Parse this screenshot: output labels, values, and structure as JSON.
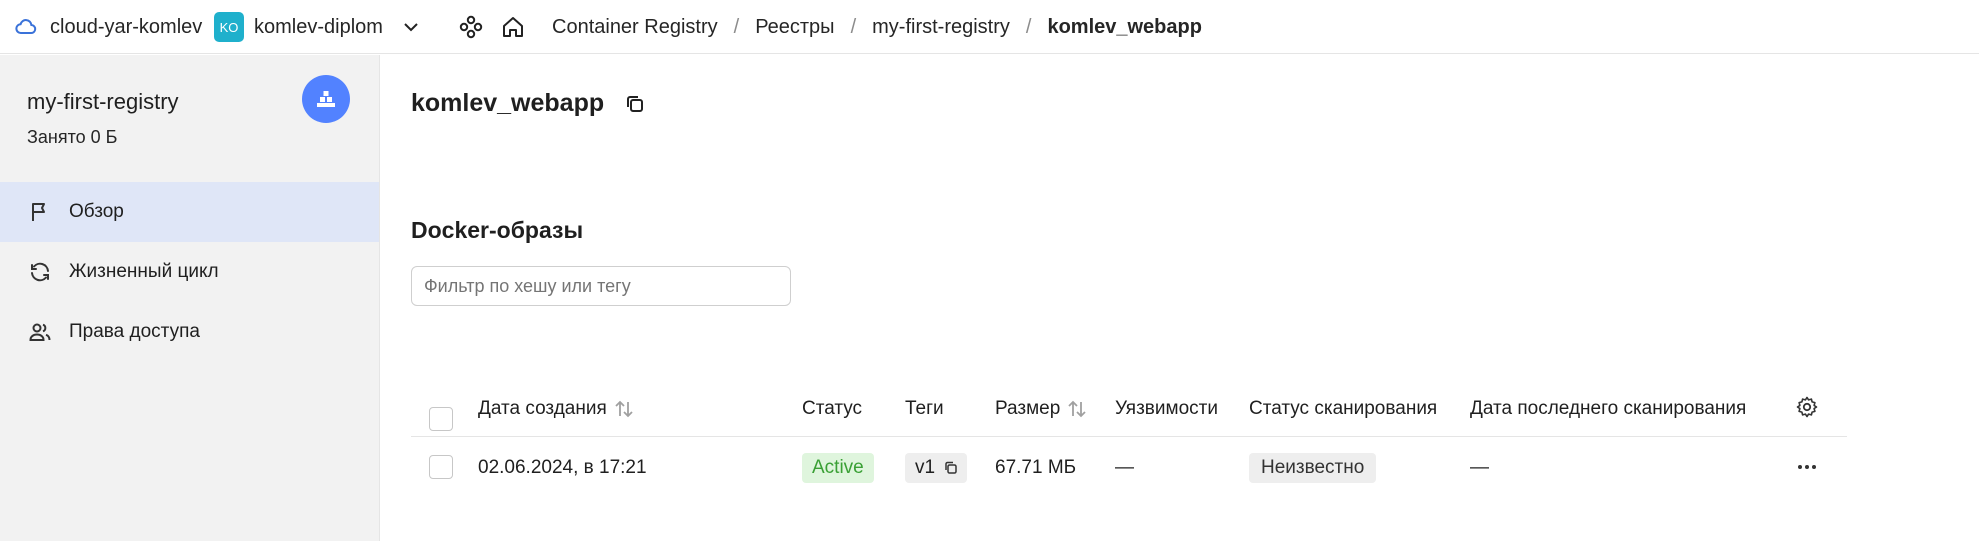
{
  "topbar": {
    "cloud": "cloud-yar-komlev",
    "folder_badge": "KO",
    "folder": "komlev-diplom",
    "breadcrumbs": [
      "Container Registry",
      "Реестры",
      "my-first-registry",
      "komlev_webapp"
    ],
    "separator": "/"
  },
  "sidebar": {
    "registry_name": "my-first-registry",
    "occupied": "Занято 0 Б",
    "items": [
      {
        "label": "Обзор",
        "icon": "flag-icon",
        "active": true
      },
      {
        "label": "Жизненный цикл",
        "icon": "refresh-icon",
        "active": false
      },
      {
        "label": "Права доступа",
        "icon": "users-icon",
        "active": false
      }
    ]
  },
  "main": {
    "title": "komlev_webapp",
    "section_title": "Docker-образы",
    "filter_placeholder": "Фильтр по хешу или тегу",
    "columns": [
      "Дата создания",
      "Статус",
      "Теги",
      "Размер",
      "Уязвимости",
      "Статус сканирования",
      "Дата последнего сканирования"
    ],
    "rows": [
      {
        "date": "02.06.2024, в 17:21",
        "status": "Active",
        "tag": "v1",
        "size": "67.71 МБ",
        "vulns": "—",
        "scan_status": "Неизвестно",
        "last_scan": "—"
      }
    ]
  },
  "colors": {
    "accent": "#5282ff",
    "active_nav": "#dfe6f7",
    "status_green_bg": "#dff5dd",
    "status_green_text": "#3aa035",
    "badge_teal": "#1fb0cc"
  }
}
